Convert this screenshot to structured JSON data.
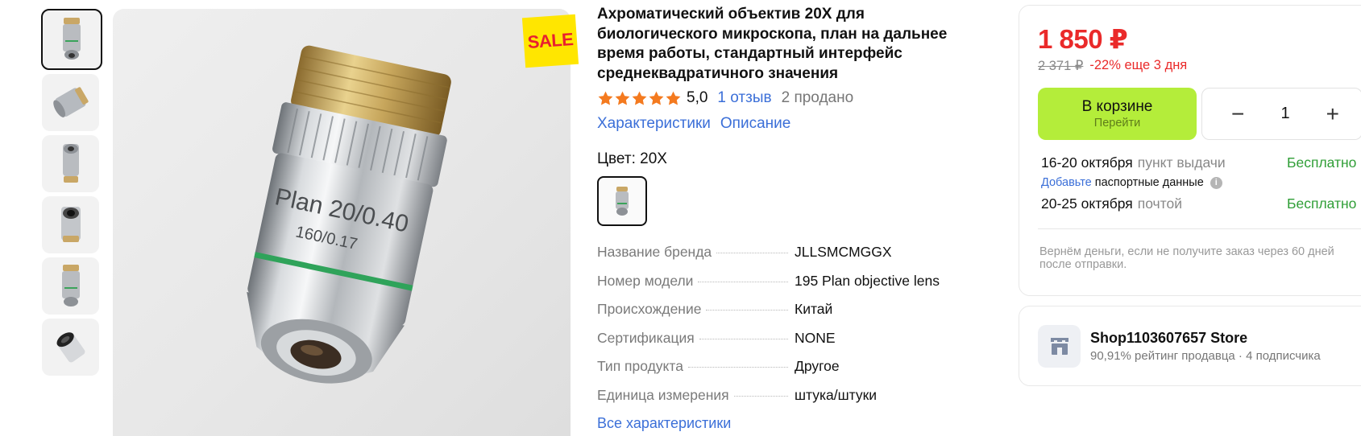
{
  "product": {
    "sale_badge": "SALE",
    "title": "Ахроматический объектив 20X для биологического микроскопа, план на дальнее время работы, стандартный интерфейс среднеквадратичного значения",
    "rating": "5,0",
    "stars": 5,
    "reviews_link": "1 отзыв",
    "sold": "2 продано",
    "tabs": [
      "Характеристики",
      "Описание"
    ],
    "color_label": "Цвет: 20X",
    "lens_text_1": "Plan 20/0.40",
    "lens_text_2": "160/0.17"
  },
  "specs": [
    {
      "key": "Название бренда",
      "value": "JLLSMCMGGX"
    },
    {
      "key": "Номер модели",
      "value": "195 Plan objective lens"
    },
    {
      "key": "Происхождение",
      "value": "Китай"
    },
    {
      "key": "Сертификация",
      "value": "NONE"
    },
    {
      "key": "Тип продукта",
      "value": "Другое"
    },
    {
      "key": "Единица измерения",
      "value": "штука/штуки"
    }
  ],
  "all_specs_link": "Все характеристики",
  "buybox": {
    "price": "1 850 ₽",
    "old_price": "2 371 ₽",
    "discount": "-22% еще 3 дня",
    "cart_label": "В корзине",
    "cart_sub": "Перейти",
    "qty_minus": "−",
    "qty_value": "1",
    "qty_plus": "+",
    "delivery": [
      {
        "date": "16-20 октября",
        "type": "пункт выдачи",
        "price": "Бесплатно"
      },
      {
        "date": "20-25 октября",
        "type": "почтой",
        "price": "Бесплатно"
      }
    ],
    "note_link": "Добавьте",
    "note_text": "паспортные данные",
    "guarantee": "Вернём деньги, если не получите заказ через 60 дней после отправки."
  },
  "store": {
    "name": "Shop1103607657 Store",
    "meta": "90,91% рейтинг продавца · 4 подписчика"
  },
  "colors": {
    "price_red": "#ea2a2a",
    "link_blue": "#3b6fd8",
    "cart_green": "#b4ed3a",
    "free_green": "#2f9e36",
    "star_orange": "#f47a1f"
  }
}
